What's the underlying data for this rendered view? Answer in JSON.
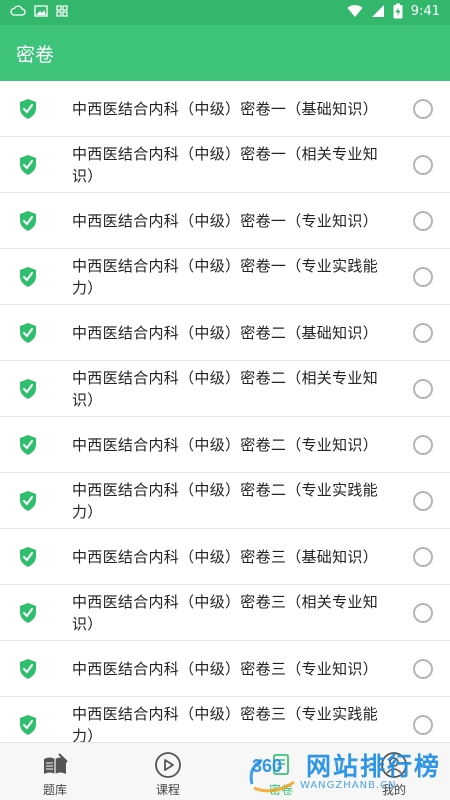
{
  "status_bar": {
    "time": "9:41",
    "icons": [
      "cloud-icon",
      "image-icon",
      "grid-icon",
      "wifi-icon",
      "signal-icon",
      "battery-charging-icon"
    ]
  },
  "header": {
    "title": "密卷"
  },
  "colors": {
    "primary": "#3ec47a",
    "status_bar": "#33b76d",
    "shield": "#2fbf6e",
    "radio_border": "#b5b5b5"
  },
  "papers": [
    {
      "label": "中西医结合内科（中级）密卷一（基础知识）",
      "selected": false
    },
    {
      "label": "中西医结合内科（中级）密卷一（相关专业知识）",
      "selected": false
    },
    {
      "label": "中西医结合内科（中级）密卷一（专业知识）",
      "selected": false
    },
    {
      "label": "中西医结合内科（中级）密卷一（专业实践能力）",
      "selected": false
    },
    {
      "label": "中西医结合内科（中级）密卷二（基础知识）",
      "selected": false
    },
    {
      "label": "中西医结合内科（中级）密卷二（相关专业知识）",
      "selected": false
    },
    {
      "label": "中西医结合内科（中级）密卷二（专业知识）",
      "selected": false
    },
    {
      "label": "中西医结合内科（中级）密卷二（专业实践能力）",
      "selected": false
    },
    {
      "label": "中西医结合内科（中级）密卷三（基础知识）",
      "selected": false
    },
    {
      "label": "中西医结合内科（中级）密卷三（相关专业知识）",
      "selected": false
    },
    {
      "label": "中西医结合内科（中级）密卷三（专业知识）",
      "selected": false
    },
    {
      "label": "中西医结合内科（中级）密卷三（专业实践能力）",
      "selected": false
    }
  ],
  "bottom_nav": {
    "items": [
      {
        "label": "题库",
        "icon": "book-icon"
      },
      {
        "label": "课程",
        "icon": "play-circle-icon"
      },
      {
        "label": "密卷",
        "icon": "paper-icon"
      },
      {
        "label": "我的",
        "icon": "user-icon"
      }
    ]
  },
  "watermark": {
    "text": "网站排行榜",
    "sub": "WANGZHANB.CN",
    "badge": "360"
  }
}
